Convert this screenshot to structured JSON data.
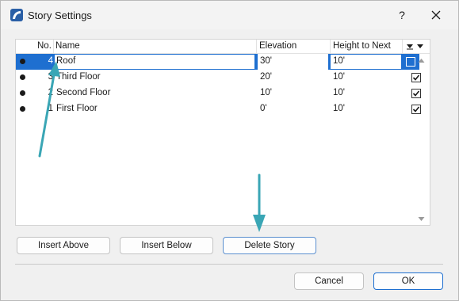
{
  "window": {
    "title": "Story Settings",
    "help_label": "?",
    "icons": {
      "app": "archicad-icon",
      "close": "close-icon"
    }
  },
  "table": {
    "columns": [
      "No.",
      "Name",
      "Elevation",
      "Height to Next"
    ],
    "rows": [
      {
        "no": "4",
        "name": "Roof",
        "elevation": "30'",
        "height": "10'",
        "checked": false,
        "selected": true
      },
      {
        "no": "3",
        "name": "Third Floor",
        "elevation": "20'",
        "height": "10'",
        "checked": true,
        "selected": false
      },
      {
        "no": "2",
        "name": "Second Floor",
        "elevation": "10'",
        "height": "10'",
        "checked": true,
        "selected": false
      },
      {
        "no": "1",
        "name": "First Floor",
        "elevation": "0'",
        "height": "10'",
        "checked": true,
        "selected": false
      }
    ]
  },
  "buttons": {
    "insert_above": "Insert Above",
    "insert_below": "Insert Below",
    "delete_story": "Delete Story",
    "cancel": "Cancel",
    "ok": "OK"
  },
  "colors": {
    "selection": "#1e6fd0",
    "annotation_arrow": "#3aa6b5"
  }
}
